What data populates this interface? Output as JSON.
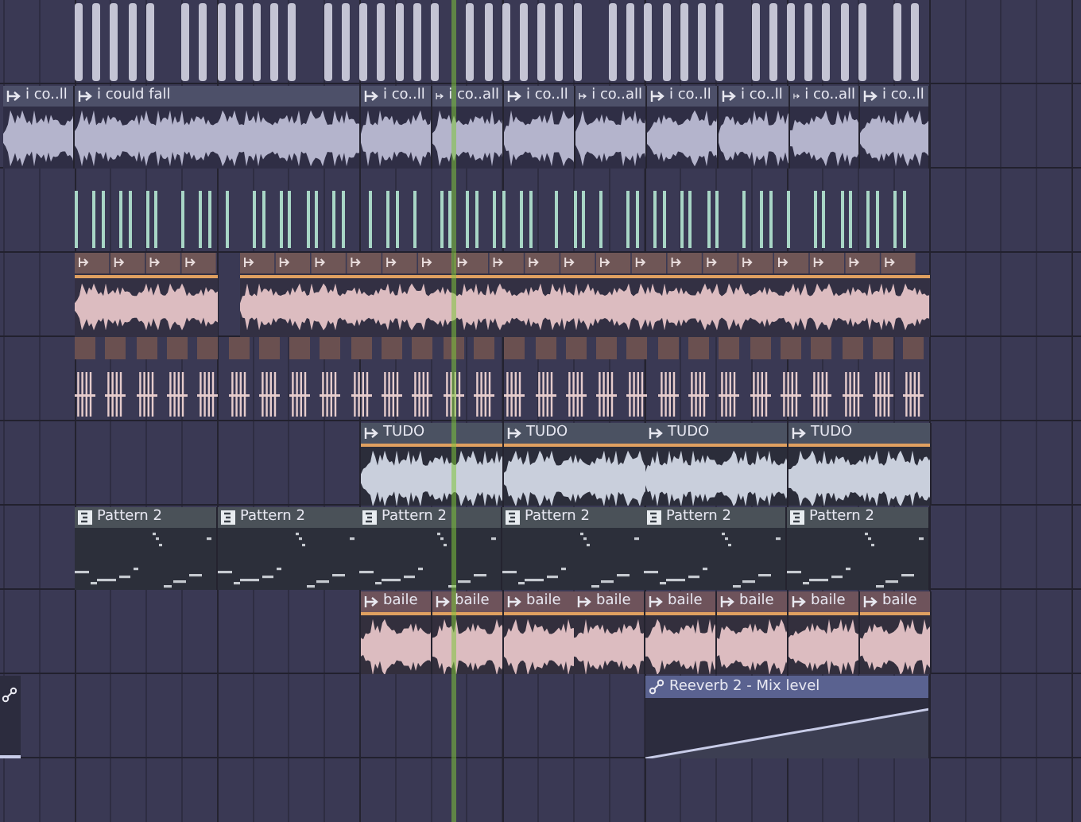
{
  "playlist": {
    "tracks": [
      {
        "kind": "hits"
      },
      {
        "kind": "audio",
        "color": "#b4b4cc",
        "clips": [
          "i co..ll",
          "i could fall",
          "i co..ll",
          "i co..all",
          "i co..ll",
          "i co..all",
          "i co..ll",
          "i co..ll",
          "i co..all",
          "i co..ll"
        ]
      },
      {
        "kind": "ticks"
      },
      {
        "kind": "sliced"
      },
      {
        "kind": "chops"
      },
      {
        "kind": "audio",
        "color": "#c9cfdc",
        "clips": [
          "TUDO",
          "TUDO",
          "TUDO",
          "TUDO"
        ]
      },
      {
        "kind": "pattern",
        "clips": [
          "Pattern 2",
          "Pattern 2",
          "Pattern 2",
          "Pattern 2",
          "Pattern 2",
          "Pattern 2"
        ]
      },
      {
        "kind": "audio",
        "color": "#dcbcc0",
        "clips": [
          "baile",
          "baile",
          "baile",
          "baile",
          "baile",
          "baile",
          "baile",
          "baile"
        ]
      },
      {
        "kind": "automation",
        "clips": [
          "Reeverb 2 - Mix level"
        ]
      },
      {
        "kind": "empty"
      }
    ]
  }
}
